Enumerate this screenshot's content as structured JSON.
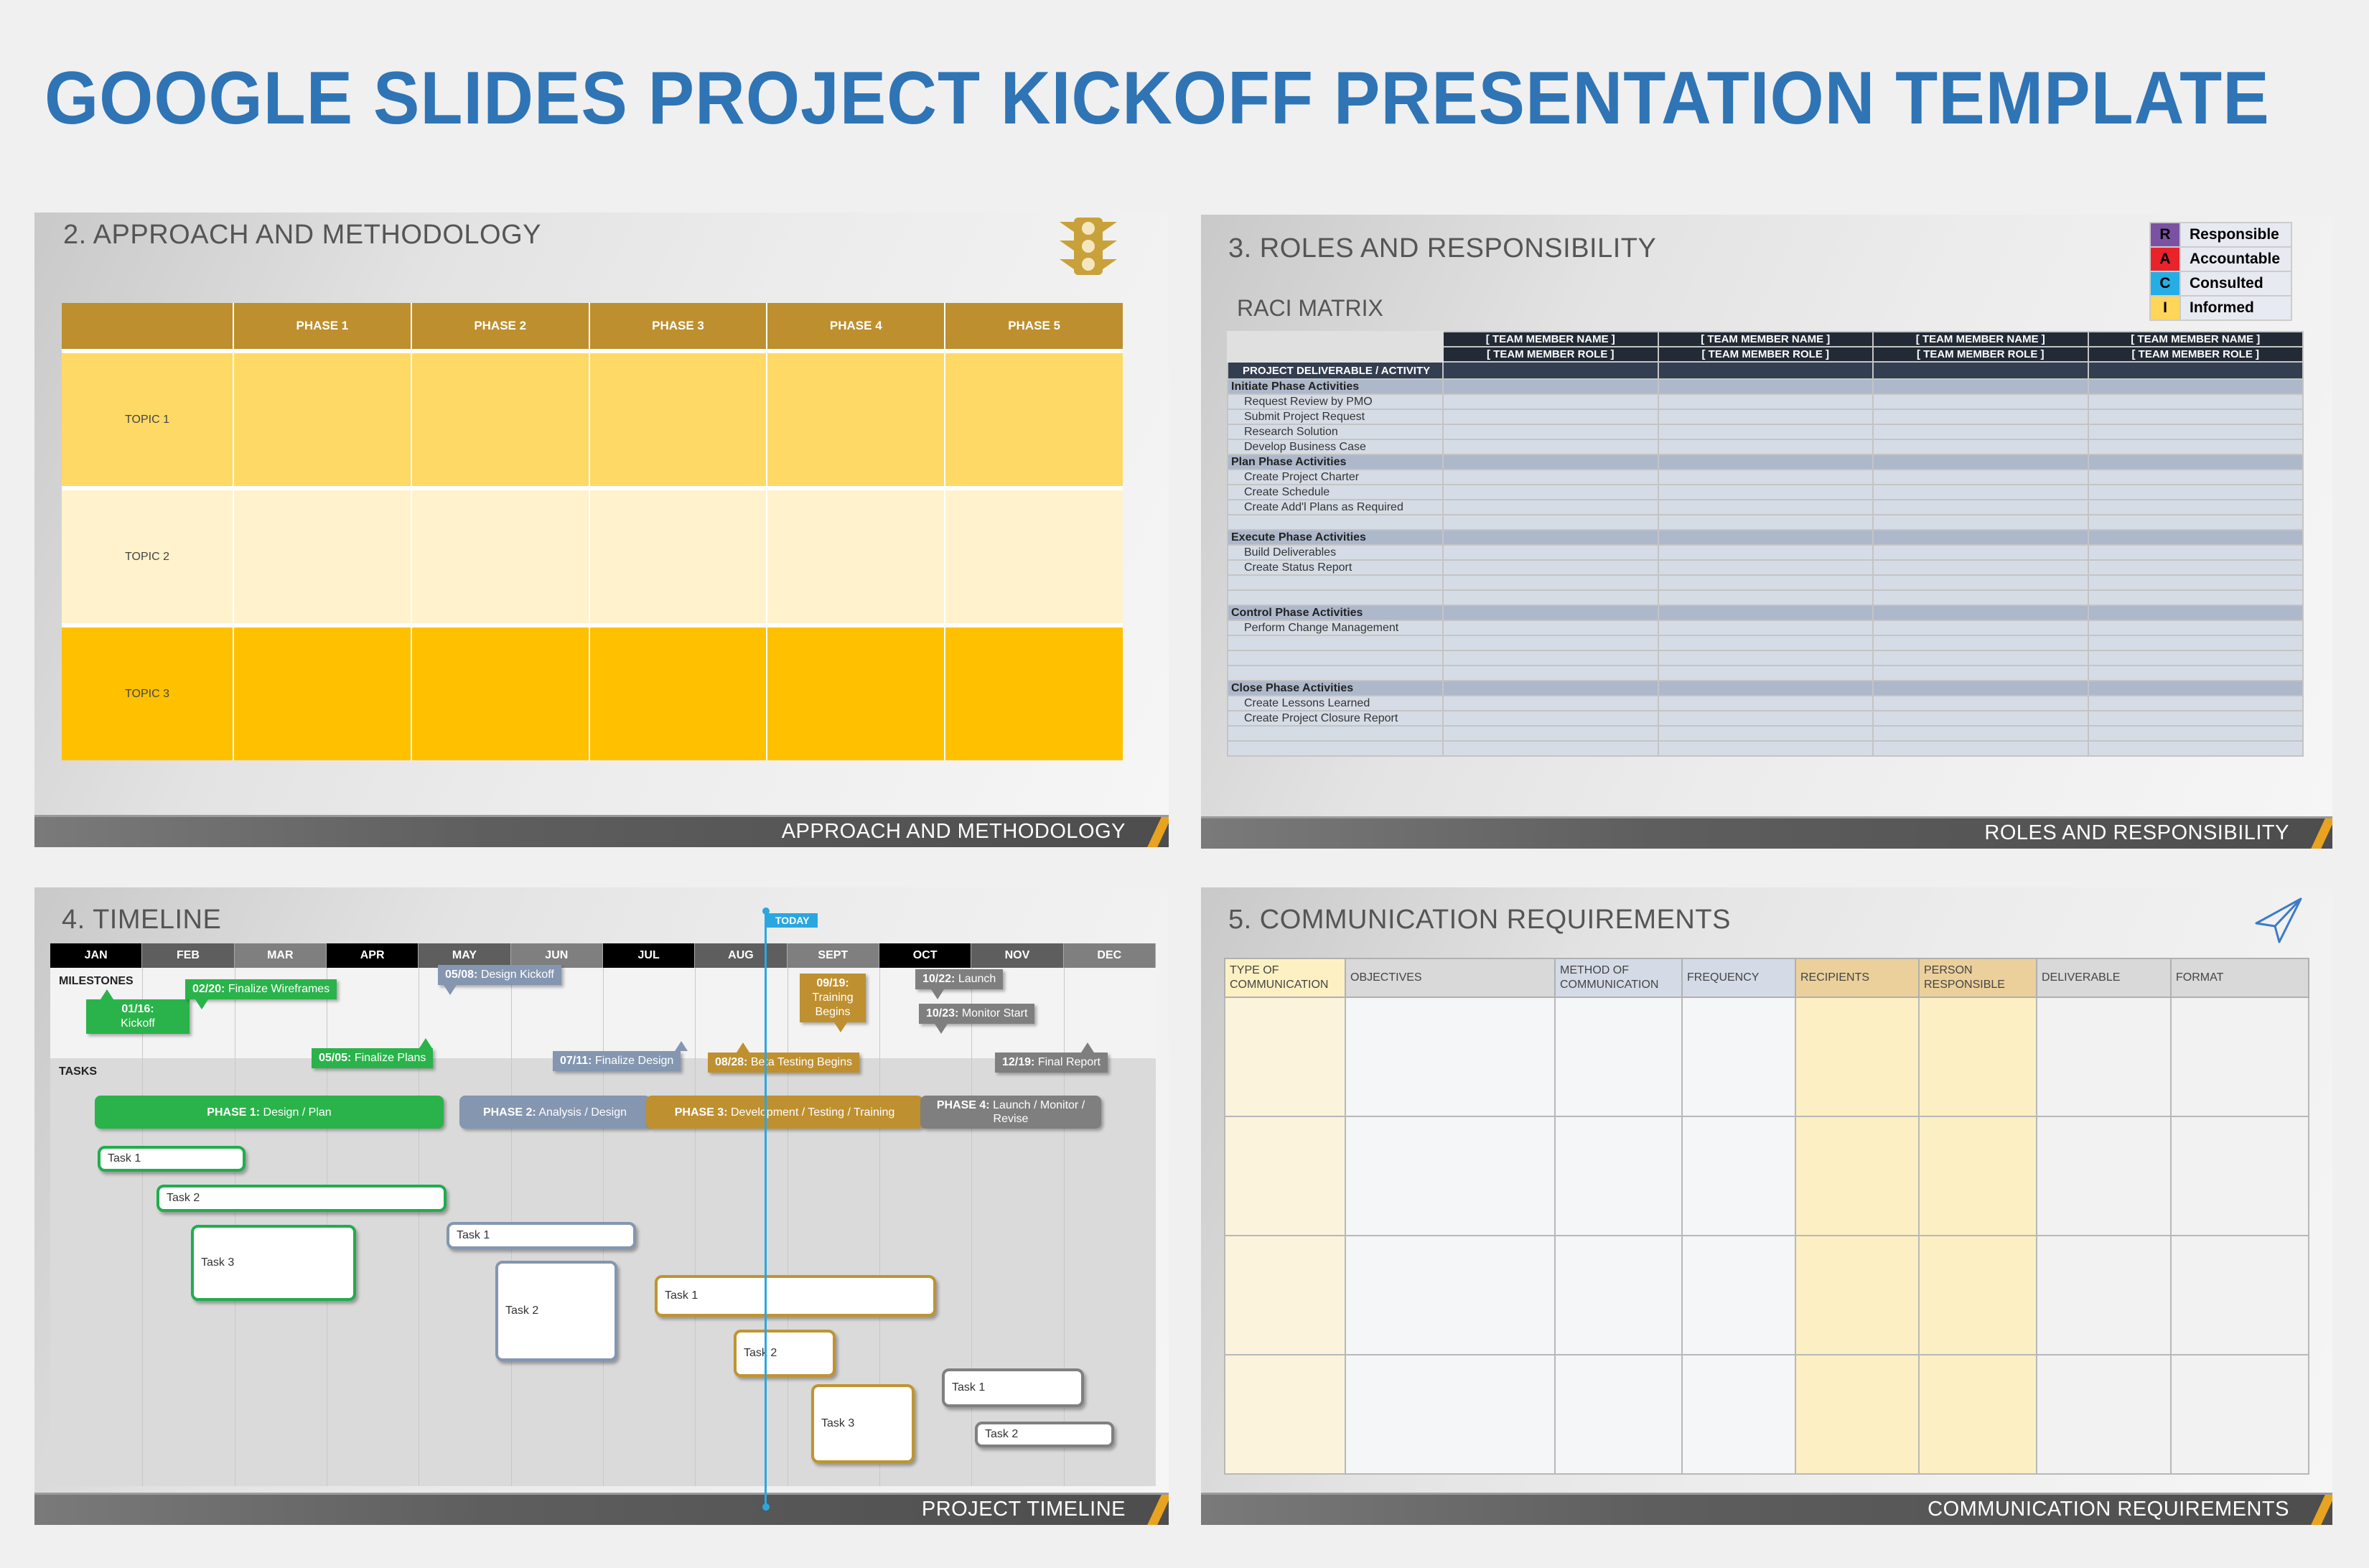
{
  "page_title": "GOOGLE SLIDES PROJECT KICKOFF PRESENTATION TEMPLATE",
  "slides": {
    "approach": {
      "title": "2. APPROACH AND METHODOLOGY",
      "icon": "traffic-light-icon",
      "columns": [
        "",
        "PHASE 1",
        "PHASE 2",
        "PHASE 3",
        "PHASE 4",
        "PHASE 5"
      ],
      "rows": [
        "TOPIC 1",
        "TOPIC 2",
        "TOPIC 3"
      ],
      "footer": "APPROACH AND METHODOLOGY",
      "colors": {
        "header": "#bd8f2e",
        "row1": "#ffd966",
        "row2": "#fff2cc",
        "row3": "#ffc000"
      }
    },
    "roles": {
      "title": "3. ROLES AND RESPONSIBILITY",
      "subtitle": "RACI MATRIX",
      "legend": [
        {
          "key": "R",
          "label": "Responsible",
          "color": "#7b52a3"
        },
        {
          "key": "A",
          "label": "Accountable",
          "color": "#e8232a"
        },
        {
          "key": "C",
          "label": "Consulted",
          "color": "#25aee6"
        },
        {
          "key": "I",
          "label": "Informed",
          "color": "#ffd55a"
        }
      ],
      "member_name": "[ TEAM MEMBER NAME ]",
      "member_role": "[ TEAM MEMBER ROLE ]",
      "activity_header": "PROJECT DELIVERABLE / ACTIVITY",
      "rows": [
        {
          "type": "sec",
          "label": "Initiate Phase Activities"
        },
        {
          "type": "item",
          "label": "Request Review by PMO"
        },
        {
          "type": "item",
          "label": "Submit Project Request"
        },
        {
          "type": "item",
          "label": "Research Solution"
        },
        {
          "type": "item",
          "label": "Develop Business Case"
        },
        {
          "type": "sec",
          "label": "Plan Phase Activities"
        },
        {
          "type": "item",
          "label": "Create Project Charter"
        },
        {
          "type": "item",
          "label": "Create Schedule"
        },
        {
          "type": "item",
          "label": "Create Add'l Plans as Required"
        },
        {
          "type": "item",
          "label": ""
        },
        {
          "type": "sec",
          "label": "Execute Phase Activities"
        },
        {
          "type": "item",
          "label": "Build Deliverables"
        },
        {
          "type": "item",
          "label": "Create Status Report"
        },
        {
          "type": "item",
          "label": ""
        },
        {
          "type": "item",
          "label": ""
        },
        {
          "type": "sec",
          "label": "Control Phase Activities"
        },
        {
          "type": "item",
          "label": "Perform Change Management"
        },
        {
          "type": "item",
          "label": ""
        },
        {
          "type": "item",
          "label": ""
        },
        {
          "type": "item",
          "label": ""
        },
        {
          "type": "sec",
          "label": "Close Phase Activities"
        },
        {
          "type": "item",
          "label": "Create Lessons Learned"
        },
        {
          "type": "item",
          "label": "Create Project Closure Report"
        },
        {
          "type": "item",
          "label": ""
        },
        {
          "type": "item",
          "label": ""
        }
      ],
      "footer": "ROLES AND RESPONSIBILITY"
    },
    "timeline": {
      "title": "4. TIMELINE",
      "today_label": "TODAY",
      "months": [
        "JAN",
        "FEB",
        "MAR",
        "APR",
        "MAY",
        "JUN",
        "JUL",
        "AUG",
        "SEPT",
        "OCT",
        "NOV",
        "DEC"
      ],
      "month_colors": [
        "#000000",
        "#5e5e5e",
        "#7f7f7f",
        "#000000",
        "#5e5e5e",
        "#7f7f7f",
        "#000000",
        "#5e5e5e",
        "#7f7f7f",
        "#000000",
        "#5e5e5e",
        "#7f7f7f"
      ],
      "milestones_label": "MILESTONES",
      "tasks_label": "TASKS",
      "milestones": [
        {
          "date": "01/16:",
          "text": "Kickoff",
          "color": "green"
        },
        {
          "date": "02/20:",
          "text": "Finalize Wireframes",
          "color": "green"
        },
        {
          "date": "05/05:",
          "text": "Finalize Plans",
          "color": "green"
        },
        {
          "date": "05/08:",
          "text": "Design Kickoff",
          "color": "blue"
        },
        {
          "date": "07/11:",
          "text": "Finalize Design",
          "color": "blue"
        },
        {
          "date": "08/28:",
          "text": "Beta Testing Begins",
          "color": "gold"
        },
        {
          "date": "09/19:",
          "text": "Training Begins",
          "color": "gold"
        },
        {
          "date": "10/22:",
          "text": "Launch",
          "color": "gray"
        },
        {
          "date": "10/23:",
          "text": "Monitor Start",
          "color": "gray"
        },
        {
          "date": "12/19:",
          "text": "Final Report",
          "color": "gray"
        }
      ],
      "phases": [
        {
          "label": "PHASE 1:",
          "text": "Design / Plan"
        },
        {
          "label": "PHASE 2:",
          "text": "Analysis / Design"
        },
        {
          "label": "PHASE 3:",
          "text": "Development / Testing / Training"
        },
        {
          "label": "PHASE 4:",
          "text": "Launch / Monitor / Revise"
        }
      ],
      "tasks": [
        "Task 1",
        "Task 2",
        "Task 3",
        "Task 1",
        "Task 2",
        "Task 1",
        "Task 2",
        "Task 3",
        "Task 1",
        "Task 2"
      ],
      "footer": "PROJECT TIMELINE"
    },
    "communication": {
      "title": "5. COMMUNICATION REQUIREMENTS",
      "icon": "paper-plane-icon",
      "columns": [
        "TYPE OF COMMUNICATION",
        "OBJECTIVES",
        "METHOD OF COMMUNICATION",
        "FREQUENCY",
        "RECIPIENTS",
        "PERSON RESPONSIBLE",
        "DELIVERABLE",
        "FORMAT"
      ],
      "footer": "COMMUNICATION REQUIREMENTS"
    }
  }
}
